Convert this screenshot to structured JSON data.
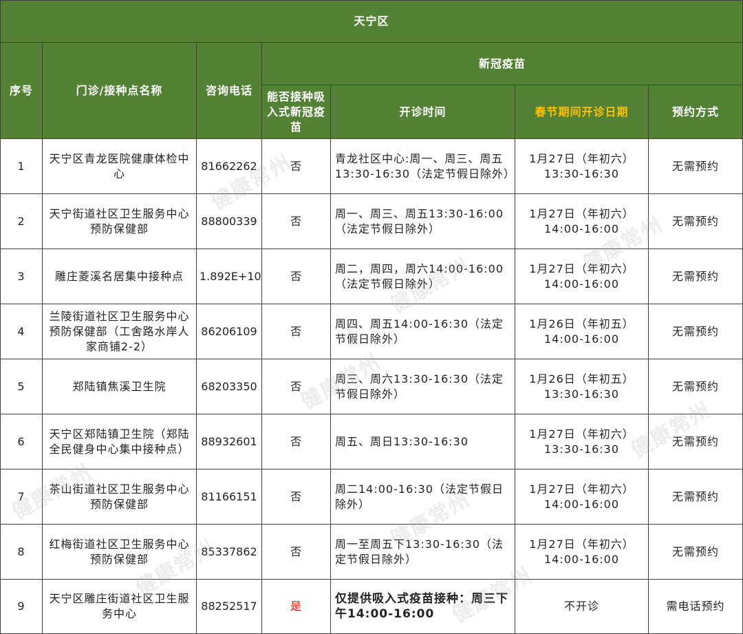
{
  "district": "天宁区",
  "headers": {
    "index": "序号",
    "name": "门诊/接种点名称",
    "phone": "咨询电话",
    "vaccine_group": "新冠疫苗",
    "inhaled": "能否接种吸入式新冠疫苗",
    "hours": "开诊时间",
    "festival": "春节期间开诊日期",
    "booking": "预约方式"
  },
  "accent_colors": {
    "header_bg": "#548235",
    "festival_header_text": "#ffc000",
    "yes_text": "#ff0000"
  },
  "rows": [
    {
      "index": "1",
      "name": "天宁区青龙医院健康体检中心",
      "phone": "81662262",
      "inhaled": "否",
      "hours": "青龙社区中心:周一、周三、周五13:30-16:30（法定节假日除外）",
      "festival": "1月27日（年初六）13:30-16:30",
      "booking": "无需预约"
    },
    {
      "index": "2",
      "name": "天宁街道社区卫生服务中心预防保健部",
      "phone": "88800339",
      "inhaled": "否",
      "hours": "周一、周三、周五13:30-16:00（法定节假日除外）",
      "festival": "1月27日（年初六）14:00-16:00",
      "booking": "无需预约"
    },
    {
      "index": "3",
      "name": "雕庄菱溪名居集中接种点",
      "phone": "1.892E+10",
      "inhaled": "否",
      "hours": "周二，周四，周六14:00-16:00（法定节假日除外）",
      "festival": "1月27日（年初六）14:00-16:00",
      "booking": "无需预约"
    },
    {
      "index": "4",
      "name": "兰陵街道社区卫生服务中心预防保健部（工舍路水岸人家商铺2-2）",
      "phone": "86206109",
      "inhaled": "否",
      "hours": "周四、周五14:00-16:30（法定节假日除外）",
      "festival": "1月26日（年初五）14:00-16:00",
      "booking": "无需预约"
    },
    {
      "index": "5",
      "name": "郑陆镇焦溪卫生院",
      "phone": "68203350",
      "inhaled": "否",
      "hours": "周三、周六13:30-16:30（法定节假日除外）",
      "festival": "1月26日（年初五）13:30-16:30",
      "booking": "无需预约"
    },
    {
      "index": "6",
      "name": "天宁区郑陆镇卫生院（郑陆全民健身中心集中接种点）",
      "phone": "88932601",
      "inhaled": "否",
      "hours": "周五、周日13:30-16:30",
      "festival": "1月27日（年初六）13:30-16:30",
      "booking": "无需预约"
    },
    {
      "index": "7",
      "name": "茶山街道社区卫生服务中心预防保健部",
      "phone": "81166151",
      "inhaled": "否",
      "hours": "周二14:00-16:30（法定节假日除外）",
      "festival": "1月27日（年初六）14:00-16:00",
      "booking": "无需预约"
    },
    {
      "index": "8",
      "name": "红梅街道社区卫生服务中心预防保健部",
      "phone": "85337862",
      "inhaled": "否",
      "hours": "周一至周五下13:30-16:30（法定节假日除外）",
      "festival": "1月27日（年初六）14:00-16:00",
      "booking": "无需预约"
    },
    {
      "index": "9",
      "name": "天宁区雕庄街道社区卫生服务中心",
      "phone": "88252517",
      "inhaled": "是",
      "hours": "仅提供吸入式疫苗接种：周三下午14:00-16:00",
      "festival": "不开诊",
      "booking": "需电话预约"
    }
  ],
  "watermark": "健康常州"
}
